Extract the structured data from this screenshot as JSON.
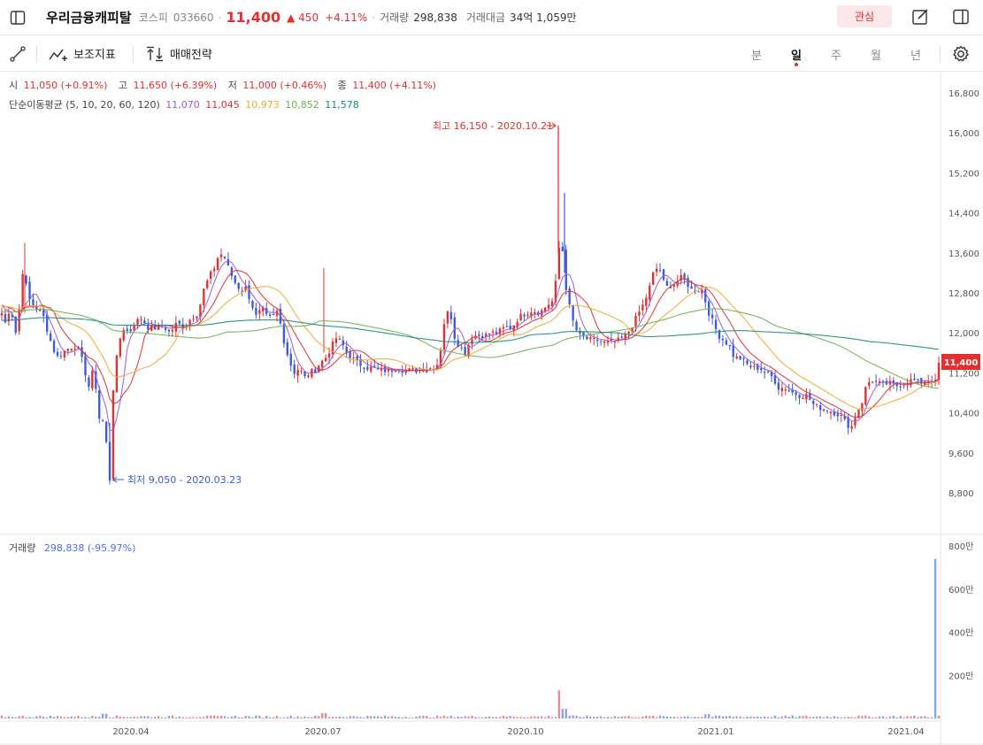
{
  "header": {
    "title": "우리금융캐피탈",
    "market": "코스피",
    "code": "033660",
    "price": "11,400",
    "change": "▲ 450",
    "change_pct": "+4.11%",
    "volume_label": "거래량",
    "volume_value": "298,838",
    "amount_label": "거래대금",
    "amount_value": "34억 1,059만",
    "favorite_label": "관심"
  },
  "toolbar": {
    "indicator_label": "보조지표",
    "strategy_label": "매매전략",
    "periods": [
      "분",
      "일",
      "주",
      "월",
      "년"
    ],
    "active_period": "일"
  },
  "ohlc": {
    "open_label": "시",
    "open_value": "11,050 (+0.91%)",
    "high_label": "고",
    "high_value": "11,650 (+6.39%)",
    "low_label": "저",
    "low_value": "11,000 (+0.46%)",
    "close_label": "종",
    "close_value": "11,400 (+4.11%)"
  },
  "ma": {
    "label": "단순이동평균 (5, 10, 20, 60, 120)",
    "values": [
      "11,070",
      "11,045",
      "10,973",
      "10,852",
      "11,578"
    ],
    "colors": [
      "#9b59d6",
      "#e22f2f",
      "#f0a830",
      "#6ab04c",
      "#1a8a7a"
    ]
  },
  "annotations": {
    "high": "최고 16,150 - 2020.10.21",
    "low": "최저 9,050 - 2020.03.23"
  },
  "volume": {
    "label": "거래량",
    "value": "298,838 (-95.97%)"
  },
  "chart_data": {
    "type": "candlestick",
    "price_axis_ticks": [
      "16,800",
      "16,000",
      "15,200",
      "14,400",
      "13,600",
      "12,800",
      "12,000",
      "11,200",
      "10,400",
      "9,600",
      "8,800"
    ],
    "price_ylim": [
      8400,
      17000
    ],
    "current_price_tag": "11,400",
    "volume_axis_ticks": [
      "800만",
      "600만",
      "400만",
      "200만"
    ],
    "x_ticks": [
      "2020.04",
      "2020.07",
      "2020.10",
      "2021.01",
      "2021.04"
    ],
    "close_path": [
      [
        0,
        12500
      ],
      [
        6,
        12200
      ],
      [
        12,
        12550
      ],
      [
        16,
        12100
      ],
      [
        19,
        11950
      ],
      [
        26,
        13300
      ],
      [
        32,
        12700
      ],
      [
        40,
        12500
      ],
      [
        48,
        12400
      ],
      [
        56,
        11900
      ],
      [
        64,
        11500
      ],
      [
        70,
        11600
      ],
      [
        78,
        11700
      ],
      [
        86,
        11750
      ],
      [
        94,
        11400
      ],
      [
        100,
        10900
      ],
      [
        106,
        11300
      ],
      [
        112,
        10300
      ],
      [
        118,
        10200
      ],
      [
        124,
        9050
      ],
      [
        128,
        10900
      ],
      [
        134,
        11800
      ],
      [
        140,
        12100
      ],
      [
        146,
        12000
      ],
      [
        152,
        12200
      ],
      [
        160,
        12300
      ],
      [
        168,
        12100
      ],
      [
        176,
        12100
      ],
      [
        184,
        12150
      ],
      [
        192,
        12000
      ],
      [
        200,
        12200
      ],
      [
        208,
        12100
      ],
      [
        216,
        12300
      ],
      [
        224,
        12400
      ],
      [
        230,
        12850
      ],
      [
        236,
        13100
      ],
      [
        242,
        13300
      ],
      [
        248,
        13600
      ],
      [
        254,
        13500
      ],
      [
        260,
        13200
      ],
      [
        266,
        13000
      ],
      [
        272,
        12850
      ],
      [
        278,
        12900
      ],
      [
        284,
        12600
      ],
      [
        290,
        12300
      ],
      [
        296,
        12500
      ],
      [
        302,
        12300
      ],
      [
        308,
        12300
      ],
      [
        314,
        12450
      ],
      [
        320,
        11900
      ],
      [
        326,
        11500
      ],
      [
        332,
        11200
      ],
      [
        338,
        11300
      ],
      [
        344,
        11100
      ],
      [
        350,
        11200
      ],
      [
        356,
        11250
      ],
      [
        362,
        11400
      ],
      [
        368,
        11500
      ],
      [
        374,
        11700
      ],
      [
        380,
        11900
      ],
      [
        386,
        11800
      ],
      [
        392,
        11600
      ],
      [
        398,
        11500
      ],
      [
        404,
        11400
      ],
      [
        410,
        11350
      ],
      [
        416,
        11300
      ],
      [
        422,
        11300
      ],
      [
        428,
        11250
      ],
      [
        434,
        11250
      ],
      [
        440,
        11250
      ],
      [
        448,
        11300
      ],
      [
        456,
        11250
      ],
      [
        464,
        11250
      ],
      [
        472,
        11250
      ],
      [
        480,
        11300
      ],
      [
        488,
        11300
      ],
      [
        496,
        11400
      ],
      [
        502,
        12200
      ],
      [
        508,
        12500
      ],
      [
        514,
        11900
      ],
      [
        520,
        11700
      ],
      [
        526,
        11600
      ],
      [
        532,
        11900
      ],
      [
        538,
        11950
      ],
      [
        544,
        11950
      ],
      [
        550,
        11950
      ],
      [
        556,
        12000
      ],
      [
        562,
        12000
      ],
      [
        570,
        12100
      ],
      [
        578,
        12100
      ],
      [
        586,
        12300
      ],
      [
        594,
        12400
      ],
      [
        602,
        12450
      ],
      [
        610,
        12400
      ],
      [
        618,
        12550
      ],
      [
        626,
        12650
      ],
      [
        630,
        13350
      ],
      [
        634,
        14100
      ],
      [
        638,
        13100
      ],
      [
        642,
        12650
      ],
      [
        648,
        12200
      ],
      [
        654,
        11950
      ],
      [
        660,
        11900
      ],
      [
        668,
        11850
      ],
      [
        676,
        11850
      ],
      [
        684,
        11800
      ],
      [
        692,
        11800
      ],
      [
        700,
        11850
      ],
      [
        708,
        11950
      ],
      [
        716,
        12200
      ],
      [
        722,
        12400
      ],
      [
        728,
        12600
      ],
      [
        734,
        12900
      ],
      [
        740,
        13300
      ],
      [
        746,
        13250
      ],
      [
        752,
        12900
      ],
      [
        758,
        12950
      ],
      [
        764,
        13000
      ],
      [
        770,
        13100
      ],
      [
        776,
        13000
      ],
      [
        782,
        12850
      ],
      [
        788,
        12850
      ],
      [
        794,
        12850
      ],
      [
        800,
        12450
      ],
      [
        806,
        12200
      ],
      [
        812,
        11950
      ],
      [
        818,
        11850
      ],
      [
        824,
        11750
      ],
      [
        830,
        11500
      ],
      [
        836,
        11500
      ],
      [
        842,
        11400
      ],
      [
        850,
        11300
      ],
      [
        858,
        11300
      ],
      [
        866,
        11200
      ],
      [
        874,
        11100
      ],
      [
        880,
        10900
      ],
      [
        888,
        10900
      ],
      [
        896,
        10800
      ],
      [
        904,
        10750
      ],
      [
        912,
        10750
      ],
      [
        920,
        10550
      ],
      [
        928,
        10500
      ],
      [
        936,
        10450
      ],
      [
        944,
        10400
      ],
      [
        950,
        10350
      ],
      [
        956,
        10200
      ],
      [
        962,
        10100
      ],
      [
        968,
        10400
      ],
      [
        974,
        10600
      ],
      [
        980,
        11000
      ],
      [
        986,
        11050
      ],
      [
        992,
        11000
      ],
      [
        998,
        10950
      ],
      [
        1004,
        11000
      ],
      [
        1010,
        10950
      ],
      [
        1016,
        10950
      ],
      [
        1022,
        11000
      ],
      [
        1028,
        11050
      ],
      [
        1034,
        11050
      ],
      [
        1040,
        11000
      ],
      [
        1046,
        11050
      ],
      [
        1052,
        11050
      ],
      [
        1058,
        11000
      ],
      [
        1063,
        11400
      ]
    ]
  }
}
